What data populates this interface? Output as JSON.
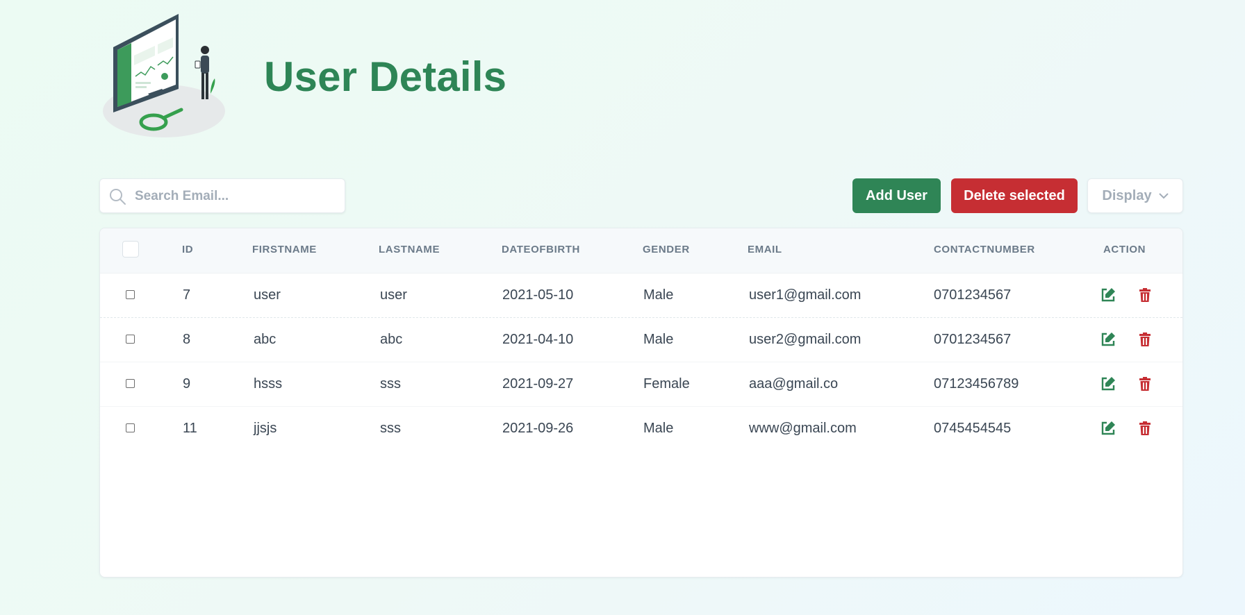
{
  "page": {
    "title": "User Details"
  },
  "search": {
    "placeholder": "Search Email...",
    "value": ""
  },
  "toolbar": {
    "add_label": "Add User",
    "delete_label": "Delete selected",
    "display_label": "Display"
  },
  "table": {
    "columns": [
      "ID",
      "FIRSTNAME",
      "LASTNAME",
      "DATEOFBIRTH",
      "GENDER",
      "EMAIL",
      "CONTACTNUMBER",
      "ACTION"
    ],
    "rows": [
      {
        "id": "7",
        "firstname": "user",
        "lastname": "user",
        "dob": "2021-05-10",
        "gender": "Male",
        "email": "user1@gmail.com",
        "contact": "0701234567"
      },
      {
        "id": "8",
        "firstname": "abc",
        "lastname": "abc",
        "dob": "2021-04-10",
        "gender": "Male",
        "email": "user2@gmail.com",
        "contact": "0701234567"
      },
      {
        "id": "9",
        "firstname": "hsss",
        "lastname": "sss",
        "dob": "2021-09-27",
        "gender": "Female",
        "email": "aaa@gmail.co",
        "contact": "07123456789"
      },
      {
        "id": "11",
        "firstname": "jjsjs",
        "lastname": "sss",
        "dob": "2021-09-26",
        "gender": "Male",
        "email": "www@gmail.com",
        "contact": "0745454545"
      }
    ]
  },
  "icons": {
    "search": "search-icon",
    "chevron": "chevron-down-icon",
    "edit": "edit-icon",
    "delete": "trash-icon"
  },
  "colors": {
    "brand_green": "#2f8556",
    "danger_red": "#c62e33",
    "title_green": "#2e8556"
  }
}
